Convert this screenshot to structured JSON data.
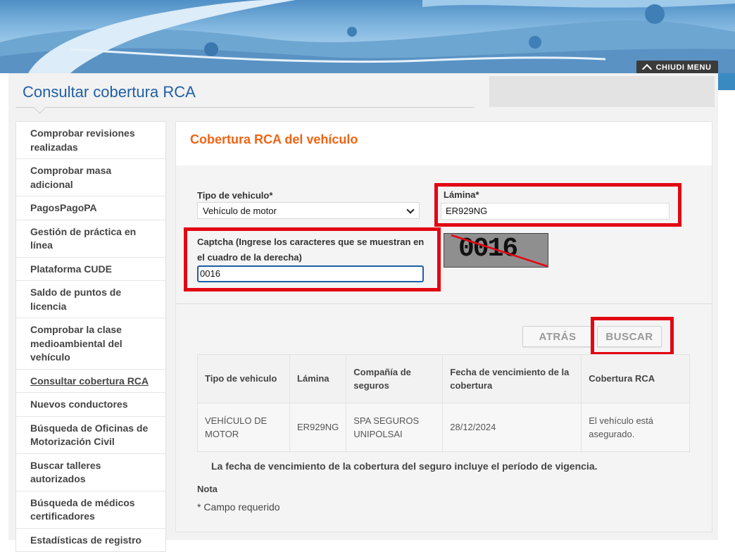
{
  "header": {
    "menu_label": "CHIUDI MENU"
  },
  "page": {
    "title": "Consultar cobertura RCA"
  },
  "sidebar": {
    "items": [
      {
        "label": "Comprobar revisiones realizadas"
      },
      {
        "label": "Comprobar masa adicional"
      },
      {
        "label": "PagosPagoPA"
      },
      {
        "label": "Gestión de práctica en línea"
      },
      {
        "label": "Plataforma CUDE"
      },
      {
        "label": "Saldo de puntos de licencia"
      },
      {
        "label": "Comprobar la clase medioambiental del vehículo"
      },
      {
        "label": "Consultar cobertura RCA"
      },
      {
        "label": "Nuevos conductores"
      },
      {
        "label": "Búsqueda de Oficinas de Motorización Civil"
      },
      {
        "label": "Buscar talleres autorizados"
      },
      {
        "label": "Búsqueda de médicos certificadores"
      },
      {
        "label": "Estadísticas de registro"
      }
    ],
    "active_index": 7
  },
  "form": {
    "section_title": "Cobertura RCA del vehículo",
    "vehicle_type_label": "Tipo de vehiculo*",
    "vehicle_type_value": "Vehículo de motor",
    "plate_label": "Lámina*",
    "plate_value": "ER929NG",
    "captcha_label": "Captcha (Ingrese los caracteres que se muestran en el cuadro de la derecha)",
    "captcha_value": "0016",
    "captcha_image_text": "0016"
  },
  "buttons": {
    "back": "ATRÁS",
    "search": "BUSCAR"
  },
  "results": {
    "headers": [
      "Tipo de vehiculo",
      "Lámina",
      "Compañía de seguros",
      "Fecha de vencimiento de la cobertura",
      "Cobertura RCA"
    ],
    "rows": [
      [
        "VEHÍCULO DE MOTOR",
        "ER929NG",
        "SPA SEGUROS UNIPOLSAI",
        "28/12/2024",
        "El vehículo está asegurado."
      ]
    ]
  },
  "notes": {
    "coverage_note": "La fecha de vencimiento de la cobertura del seguro incluye el período de vigencia.",
    "note_heading": "Nota",
    "required_note": "* Campo requerido"
  },
  "colors": {
    "title_blue": "#1f5fa6",
    "accent_orange": "#f06414",
    "highlight_red": "#e30613"
  }
}
